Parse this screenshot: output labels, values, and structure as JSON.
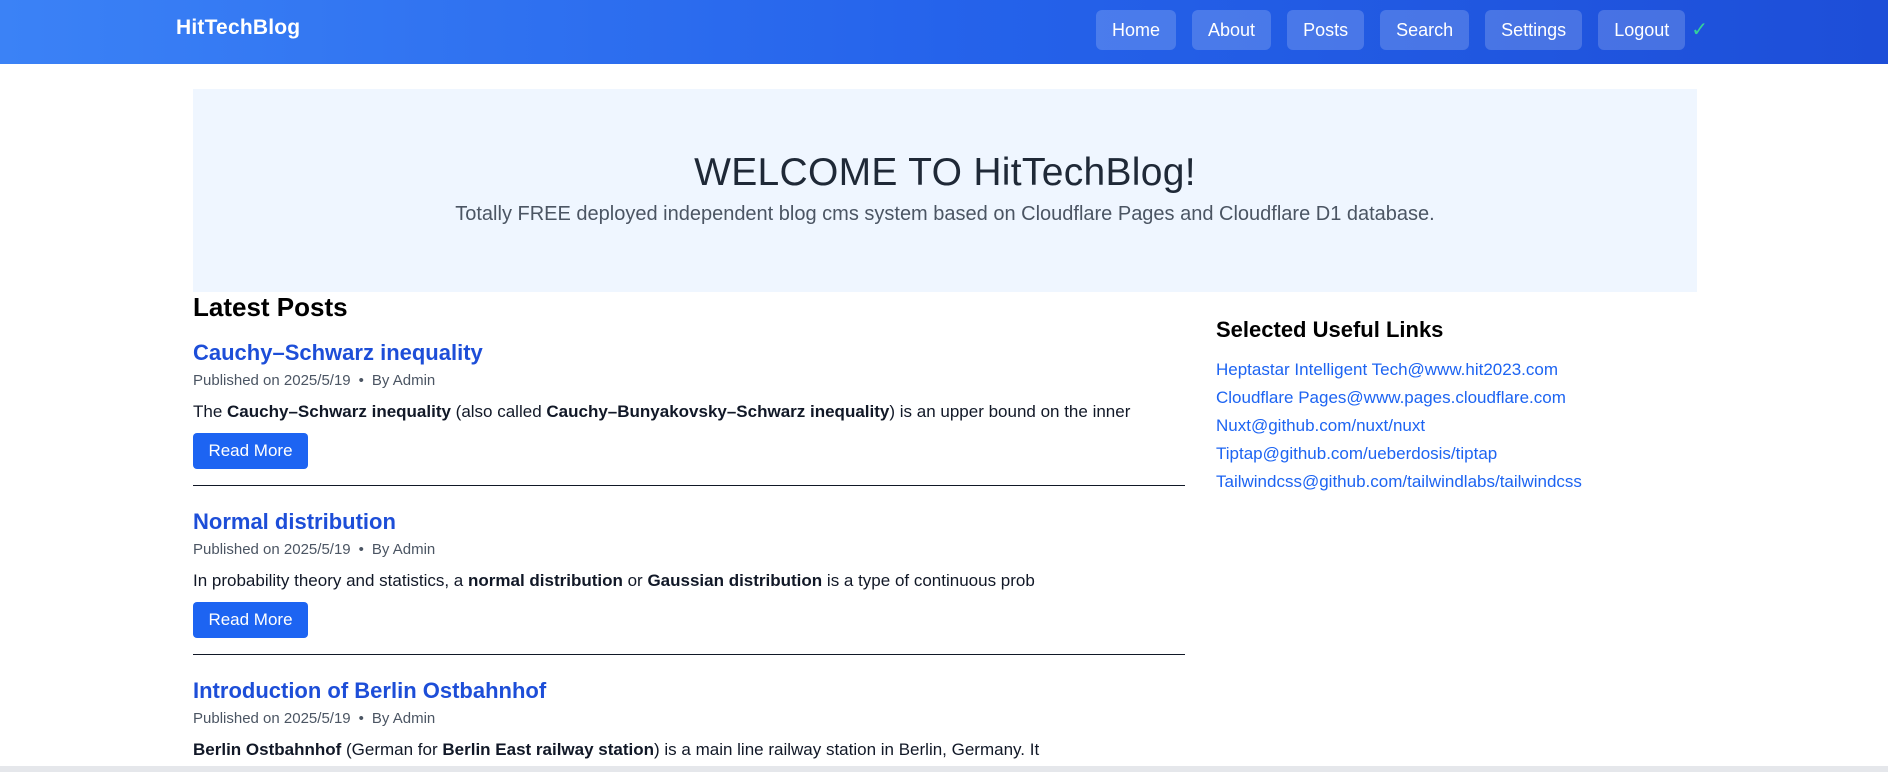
{
  "navbar": {
    "brand": "HitTechBlog",
    "items": [
      {
        "label": "Home"
      },
      {
        "label": "About"
      },
      {
        "label": "Posts"
      },
      {
        "label": "Search"
      },
      {
        "label": "Settings"
      },
      {
        "label": "Logout"
      }
    ],
    "status_icon": "check-icon",
    "status_glyph": "✓"
  },
  "hero": {
    "title": "WELCOME TO HitTechBlog!",
    "subtitle": "Totally FREE deployed independent blog cms system based on Cloudflare Pages and Cloudflare D1 database."
  },
  "latest_posts": {
    "heading": "Latest Posts",
    "read_more_label": "Read More",
    "posts": [
      {
        "title": "Cauchy–Schwarz inequality",
        "published": "Published on 2025/5/19",
        "separator": "•",
        "author": "By Admin",
        "excerpt": [
          {
            "t": "The ",
            "b": false
          },
          {
            "t": "Cauchy–Schwarz inequality",
            "b": true
          },
          {
            "t": " (also called ",
            "b": false
          },
          {
            "t": "Cauchy–Bunyakovsky–Schwarz inequality",
            "b": true
          },
          {
            "t": ") is an upper bound on the inner",
            "b": false
          }
        ]
      },
      {
        "title": "Normal distribution",
        "published": "Published on 2025/5/19",
        "separator": "•",
        "author": "By Admin",
        "excerpt": [
          {
            "t": "In probability theory and statistics, a ",
            "b": false
          },
          {
            "t": "normal distribution",
            "b": true
          },
          {
            "t": " or ",
            "b": false
          },
          {
            "t": "Gaussian distribution",
            "b": true
          },
          {
            "t": " is a type of continuous prob",
            "b": false
          }
        ]
      },
      {
        "title": "Introduction of Berlin Ostbahnhof",
        "published": "Published on 2025/5/19",
        "separator": "•",
        "author": "By Admin",
        "excerpt": [
          {
            "t": "Berlin Ostbahnhof",
            "b": true
          },
          {
            "t": " (German for ",
            "b": false
          },
          {
            "t": "Berlin East railway station",
            "b": true
          },
          {
            "t": ") is a main line railway station in Berlin, Germany. It",
            "b": false
          }
        ]
      }
    ]
  },
  "useful_links": {
    "heading": "Selected Useful Links",
    "links": [
      "Heptastar Intelligent Tech@www.hit2023.com",
      "Cloudflare Pages@www.pages.cloudflare.com",
      "Nuxt@github.com/nuxt/nuxt",
      "Tiptap@github.com/ueberdosis/tiptap",
      "Tailwindcss@github.com/tailwindlabs/tailwindcss"
    ]
  },
  "colors": {
    "nav_gradient_start": "#3b82f6",
    "nav_gradient_end": "#1d4ed8",
    "link_blue": "#1d64f2",
    "hero_bg": "#eff6ff",
    "check_green": "#34d399"
  }
}
